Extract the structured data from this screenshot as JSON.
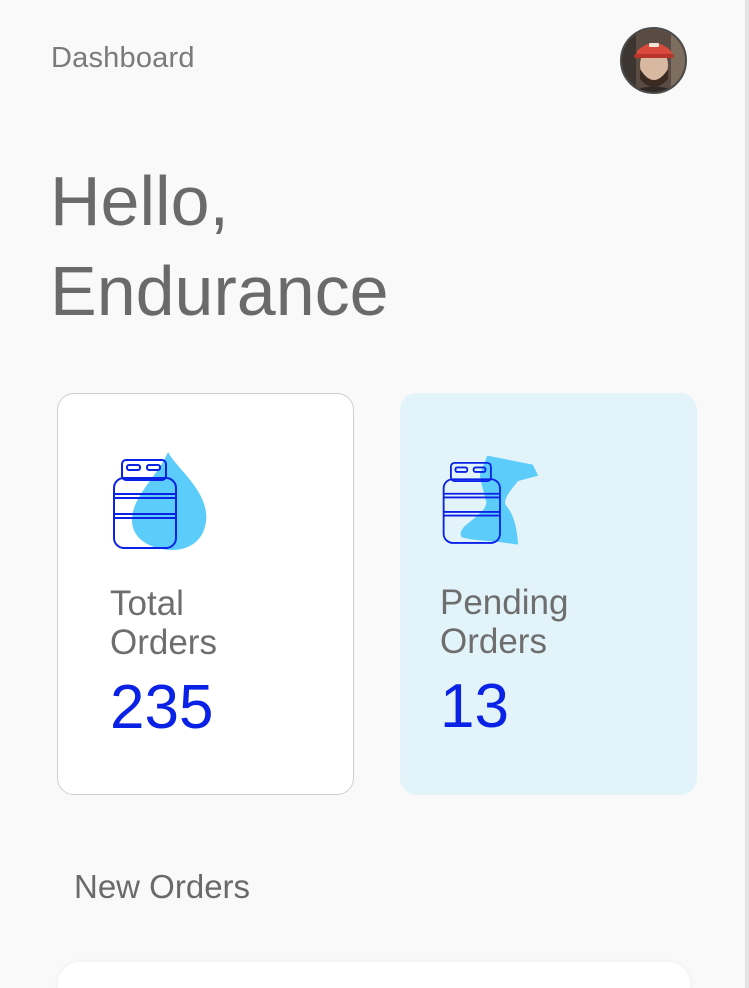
{
  "header": {
    "title": "Dashboard",
    "avatar_icon": "user-avatar"
  },
  "greeting": {
    "line1": "Hello,",
    "line2": "Endurance"
  },
  "stats": {
    "total_orders": {
      "label_line1": "Total",
      "label_line2": "Orders",
      "value": "235",
      "icon": "gas-cylinder-drop-icon"
    },
    "pending_orders": {
      "label_line1": "Pending",
      "label_line2": "Orders",
      "value": "13",
      "icon": "gas-cylinder-hourglass-icon"
    }
  },
  "new_orders": {
    "title": "New Orders"
  },
  "colors": {
    "accent": "#0a22e6",
    "icon_fill": "#5ccdfb",
    "pending_card_bg": "#e2f3f9",
    "text_muted": "#6a6a6a"
  }
}
